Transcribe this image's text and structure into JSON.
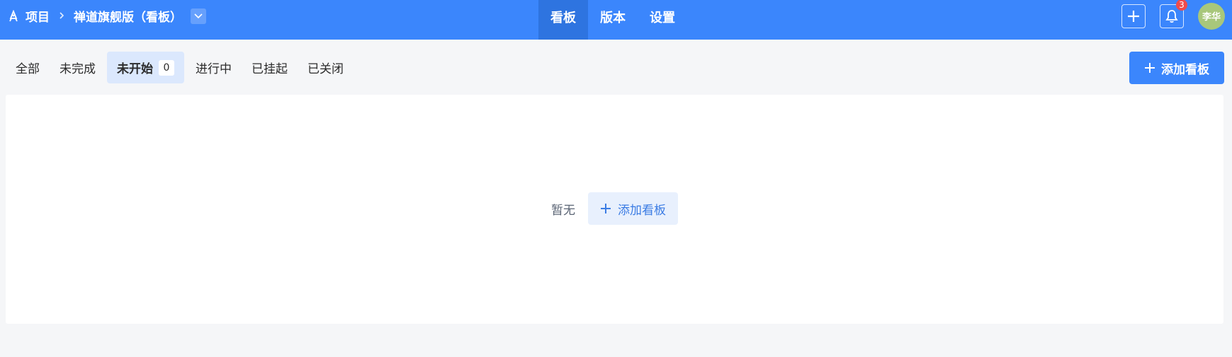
{
  "header": {
    "breadcrumb": {
      "root_label": "项目",
      "separator": ">",
      "current_label": "禅道旗舰版（看板）"
    },
    "nav_tabs": [
      {
        "label": "看板",
        "active": true
      },
      {
        "label": "版本",
        "active": false
      },
      {
        "label": "设置",
        "active": false
      }
    ],
    "notifications": {
      "count": "3"
    },
    "user": {
      "avatar_text": "李华"
    }
  },
  "filters": {
    "items": [
      {
        "label": "全部",
        "active": false
      },
      {
        "label": "未完成",
        "active": false
      },
      {
        "label": "未开始",
        "active": true,
        "count": "0"
      },
      {
        "label": "进行中",
        "active": false
      },
      {
        "label": "已挂起",
        "active": false
      },
      {
        "label": "已关闭",
        "active": false
      }
    ]
  },
  "toolbar": {
    "add_board_label": "添加看板"
  },
  "empty_state": {
    "text": "暂无",
    "add_label": "添加看板"
  },
  "colors": {
    "primary": "#3b86fc",
    "active_tab_bg": "#2e74e0",
    "filter_active_bg": "#dbe8fd",
    "badge_red": "#f04b4b",
    "avatar_bg": "#a8c77b",
    "page_bg": "#f5f6f8"
  },
  "icons": {
    "project": "rocket-icon",
    "dropdown": "chevron-down-icon",
    "create": "plus-icon",
    "notifications": "bell-icon",
    "add": "plus-icon"
  }
}
